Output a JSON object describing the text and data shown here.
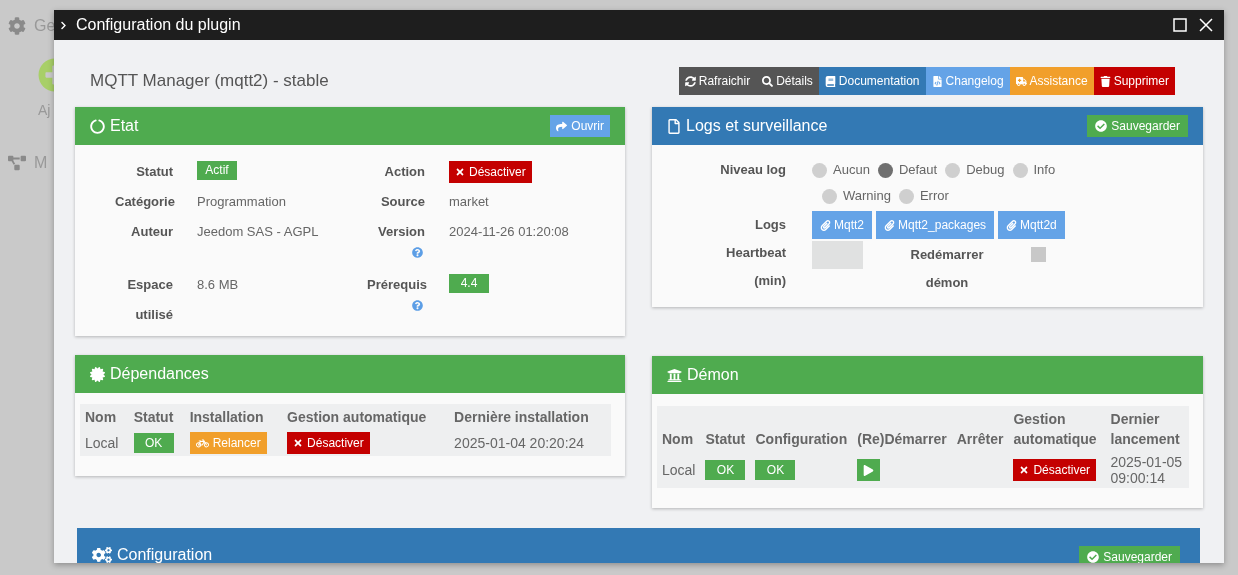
{
  "background": {
    "items": [
      {
        "label": "Ge",
        "kind": "gear"
      },
      {
        "label": "Aj",
        "kind": "add"
      },
      {
        "label": "M",
        "kind": "tree"
      }
    ]
  },
  "window": {
    "title": "Configuration du plugin"
  },
  "plugin_title": "MQTT Manager (mqtt2) - stable",
  "toolbar": [
    {
      "label": "Rafraichir",
      "kind": "refresh",
      "color": "#555555"
    },
    {
      "label": "Détails",
      "kind": "search",
      "color": "#555555"
    },
    {
      "label": "Documentation",
      "kind": "book",
      "color": "#3379b4"
    },
    {
      "label": "Changelog",
      "kind": "file",
      "color": "#64a3e7"
    },
    {
      "label": "Assistance",
      "kind": "truck",
      "color": "#f19f2b"
    },
    {
      "label": "Supprimer",
      "kind": "trash",
      "color": "#c40000"
    }
  ],
  "etat": {
    "title": "Etat",
    "open_button": "Ouvrir",
    "fields": [
      {
        "label": "Statut",
        "value": "Actif",
        "kind": "badge"
      },
      {
        "label": "Action",
        "value": "Désactiver",
        "kind": "danger"
      },
      {
        "label": "Catégorie",
        "value": "Programmation",
        "kind": "text"
      },
      {
        "label": "Source",
        "value": "market",
        "kind": "text"
      },
      {
        "label": "Auteur",
        "value": "Jeedom SAS - AGPL",
        "kind": "text"
      },
      {
        "label": "Version",
        "value": "2024-11-26 01:20:08",
        "kind": "text",
        "help": true
      },
      {
        "label": "Espace utilisé",
        "value": "8.6 MB",
        "kind": "text"
      },
      {
        "label": "Prérequis",
        "value": "4.4",
        "kind": "badge",
        "help": true
      }
    ]
  },
  "logs": {
    "title": "Logs et surveillance",
    "save_button": "Sauvegarder",
    "level_label": "Niveau log",
    "levels": [
      {
        "label": "Aucun",
        "selected": false
      },
      {
        "label": "Defaut",
        "selected": true
      },
      {
        "label": "Debug",
        "selected": false
      },
      {
        "label": "Info",
        "selected": false
      },
      {
        "label": "Warning",
        "selected": false
      },
      {
        "label": "Error",
        "selected": false
      }
    ],
    "logs_label": "Logs",
    "log_buttons": [
      "Mqtt2",
      "Mqtt2_packages",
      "Mqtt2d"
    ],
    "heartbeat_label": "Heartbeat (min)",
    "restart_label": "Redémarrer démon",
    "restart_checked": false
  },
  "dependencies": {
    "title": "Dépendances",
    "columns": [
      "Nom",
      "Statut",
      "Installation",
      "Gestion automatique",
      "Dernière installation"
    ],
    "rows": [
      [
        {
          "kind": "text",
          "text": "Local"
        },
        {
          "kind": "ok",
          "text": "OK"
        },
        {
          "kind": "warning",
          "text": "Relancer"
        },
        {
          "kind": "danger",
          "text": "Désactiver"
        },
        {
          "kind": "text",
          "text": "2025-01-04 20:20:24"
        }
      ]
    ]
  },
  "daemon": {
    "title": "Démon",
    "columns": [
      "Nom",
      "Statut",
      "Configuration",
      "(Re)Démarrer",
      "Arrêter",
      "Gestion automatique",
      "Dernier lancement"
    ],
    "rows": [
      [
        {
          "kind": "text",
          "text": "Local"
        },
        {
          "kind": "ok",
          "text": "OK"
        },
        {
          "kind": "ok",
          "text": "OK"
        },
        {
          "kind": "play"
        },
        {
          "kind": "empty"
        },
        {
          "kind": "danger",
          "text": "Désactiver"
        },
        {
          "kind": "text",
          "text": "2025-01-05 09:00:14"
        }
      ]
    ]
  },
  "configuration": {
    "title": "Configuration",
    "save_button": "Sauvegarder"
  }
}
